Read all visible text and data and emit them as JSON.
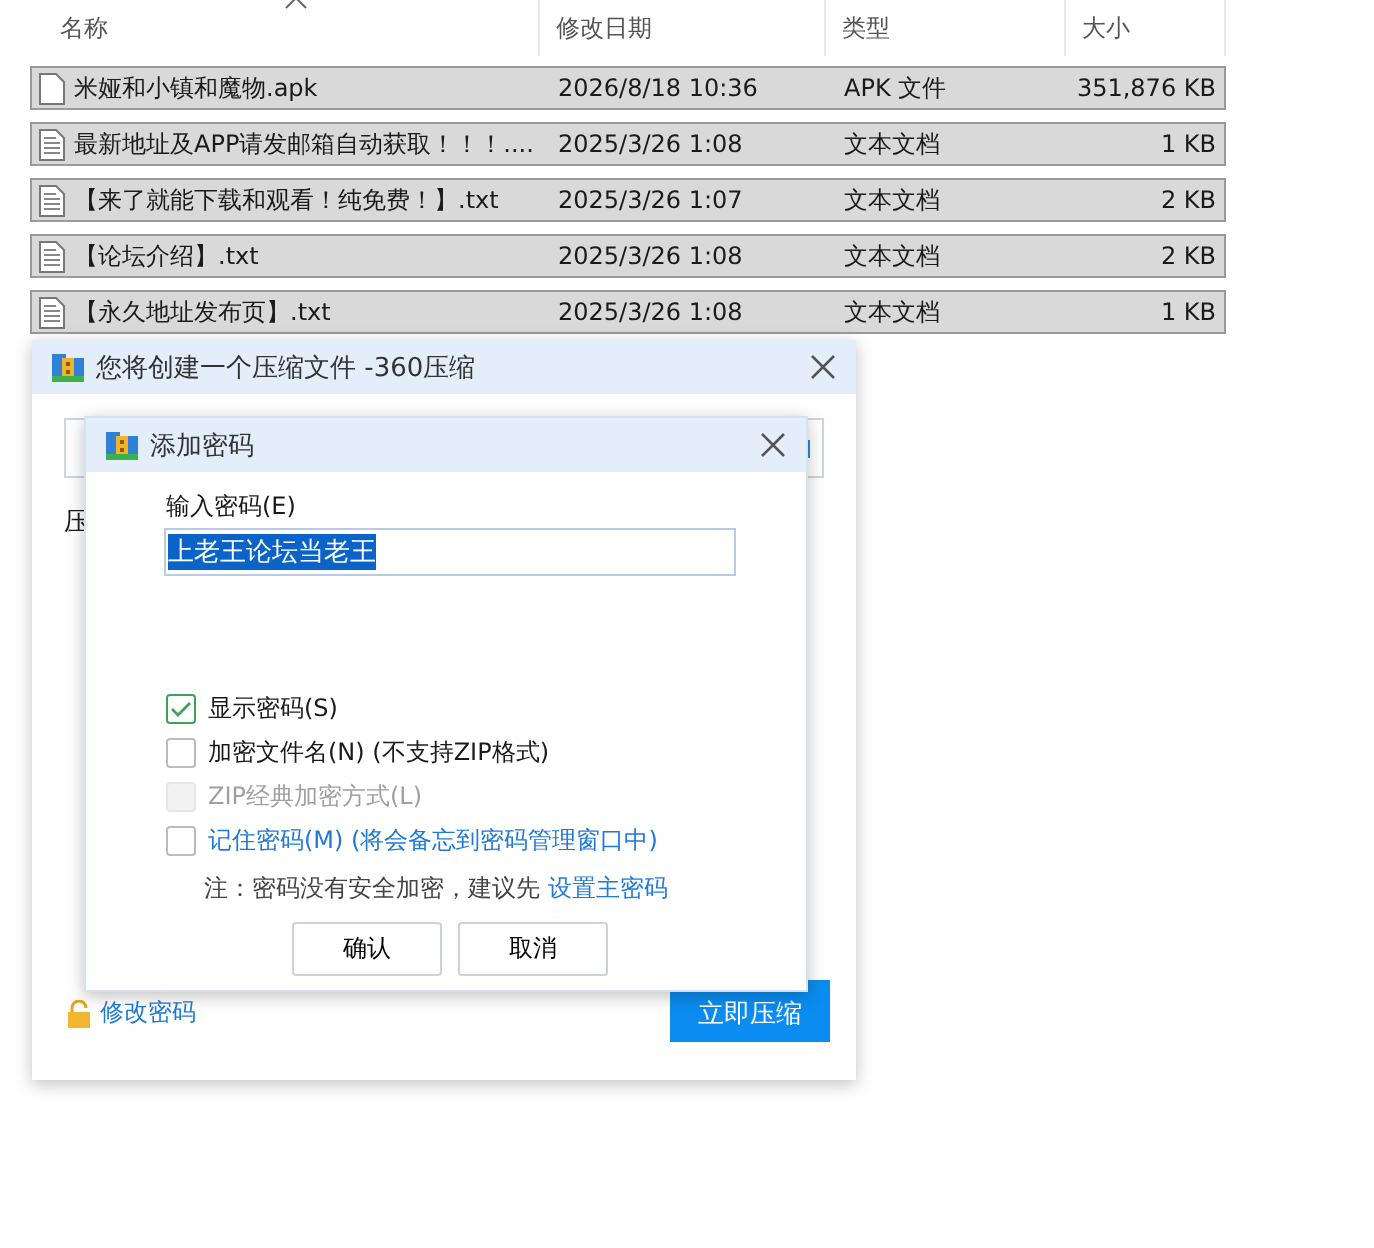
{
  "file_list": {
    "columns": [
      "名称",
      "修改日期",
      "类型",
      "大小"
    ],
    "rows": [
      {
        "name": "米娅和小镇和魔物.apk",
        "date": "2026/8/18 10:36",
        "type": "APK 文件",
        "size": "351,876 KB",
        "kind": "blank",
        "selected": true
      },
      {
        "name": "最新地址及APP请发邮箱自动获取！！！....",
        "date": "2025/3/26 1:08",
        "type": "文本文档",
        "size": "1 KB",
        "kind": "text",
        "selected": true
      },
      {
        "name": "【来了就能下载和观看！纯免费！】.txt",
        "date": "2025/3/26 1:07",
        "type": "文本文档",
        "size": "2 KB",
        "kind": "text",
        "selected": true
      },
      {
        "name": "【论坛介绍】.txt",
        "date": "2025/3/26 1:08",
        "type": "文本文档",
        "size": "2 KB",
        "kind": "text",
        "selected": true
      },
      {
        "name": "【永久地址发布页】.txt",
        "date": "2025/3/26 1:08",
        "type": "文本文档",
        "size": "1 KB",
        "kind": "text",
        "selected": true
      }
    ]
  },
  "compress_dialog": {
    "title": "您将创建一个压缩文件 -360压缩",
    "label": "压",
    "change_password_link": "修改密码",
    "compress_button": "立即压缩"
  },
  "password_dialog": {
    "title": "添加密码",
    "field_label": "输入密码(E)",
    "password": "上老王论坛当老王",
    "options": [
      {
        "label": "显示密码(S)",
        "checked": true,
        "disabled": false,
        "kind": "plain"
      },
      {
        "label": "加密文件名(N) (不支持ZIP格式)",
        "checked": false,
        "disabled": false,
        "kind": "plain"
      },
      {
        "label": "ZIP经典加密方式(L)",
        "checked": false,
        "disabled": true,
        "kind": "plain"
      },
      {
        "label": "记住密码(M) (将会备忘到密码管理窗口中)",
        "checked": false,
        "disabled": false,
        "kind": "link"
      }
    ],
    "note": "注：密码没有安全加密，建议先",
    "note_link": "设置主密码",
    "buttons": [
      "确认",
      "取消"
    ]
  }
}
